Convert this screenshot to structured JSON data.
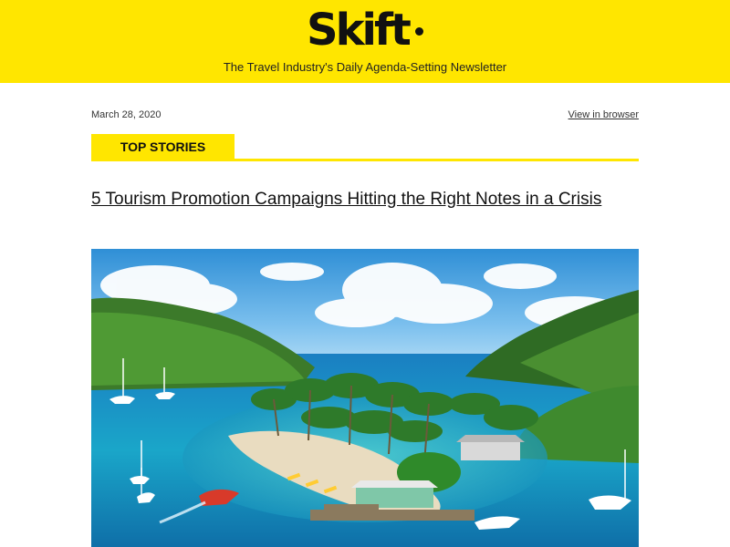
{
  "header": {
    "logo_text": "Skift",
    "tagline": "The Travel Industry's Daily Agenda-Setting Newsletter",
    "background_color": "#ffe600"
  },
  "meta": {
    "date": "March 28, 2020",
    "view_in_browser": "View in browser"
  },
  "section": {
    "label": "TOP STORIES",
    "accent_color": "#ffe600"
  },
  "story": {
    "headline": "5 Tourism Promotion Campaigns Hitting the Right Notes in a Crisis",
    "image_alt": "Tropical bay with palm trees, beach, sailboats and turquoise water"
  }
}
